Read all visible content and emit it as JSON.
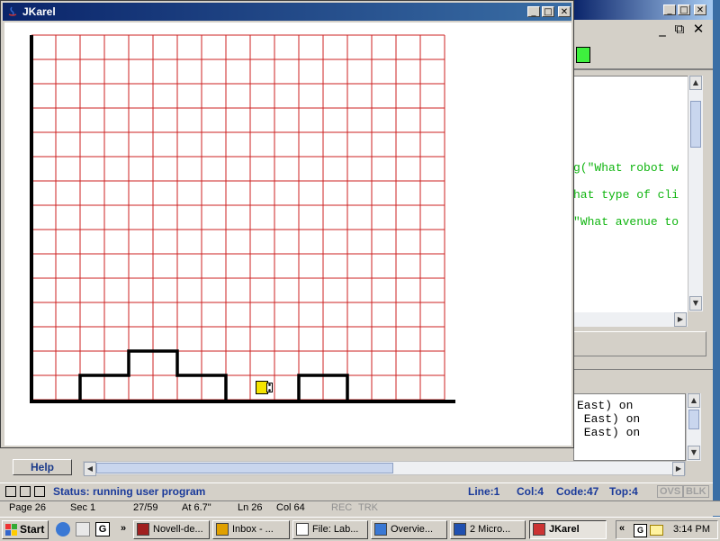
{
  "background_window": {
    "editor_lines": [
      "g(\"What robot w",
      "hat type of cli",
      "\"What avenue to"
    ],
    "output_lines": [
      "East) on",
      " East) on",
      " East) on"
    ],
    "help_label": "Help",
    "status": {
      "text": "Status: running user program",
      "line": "Line:1",
      "col": "Col:4",
      "code": "Code:47",
      "top": "Top:4",
      "ovs": "OVS",
      "blk": "BLK"
    },
    "word_status": {
      "page": "Page 26",
      "sec": "Sec 1",
      "pos": "27/59",
      "at": "At 6.7\"",
      "ln": "Ln 26",
      "col": "Col 64",
      "rec": "REC",
      "trk": "TRK"
    }
  },
  "jkarel": {
    "title": "JKarel",
    "world": {
      "streets": 15,
      "avenues": 17,
      "grid_color": "#cc2222",
      "wall_color": "#000000",
      "robot": {
        "avenue": 10,
        "street": 1,
        "facing": "East",
        "color": "#f5e400"
      }
    }
  },
  "taskbar": {
    "start_label": "Start",
    "tasks": [
      {
        "label": "Novell-de...",
        "icon": "novell-icon",
        "active": false
      },
      {
        "label": "Inbox - ...",
        "icon": "groupwise-icon",
        "active": false
      },
      {
        "label": "File: Lab...",
        "icon": "g-app-icon",
        "active": false
      },
      {
        "label": "Overvie...",
        "icon": "ie-icon",
        "active": false
      },
      {
        "label": "2 Micro...",
        "icon": "word-icon",
        "active": false
      },
      {
        "label": "JKarel",
        "icon": "java-icon",
        "active": true
      }
    ],
    "clock": "3:14 PM"
  },
  "colors": {
    "titlebar_active": "#0a246a",
    "status_blue": "#1a3a9a",
    "code_green": "#10b510"
  }
}
